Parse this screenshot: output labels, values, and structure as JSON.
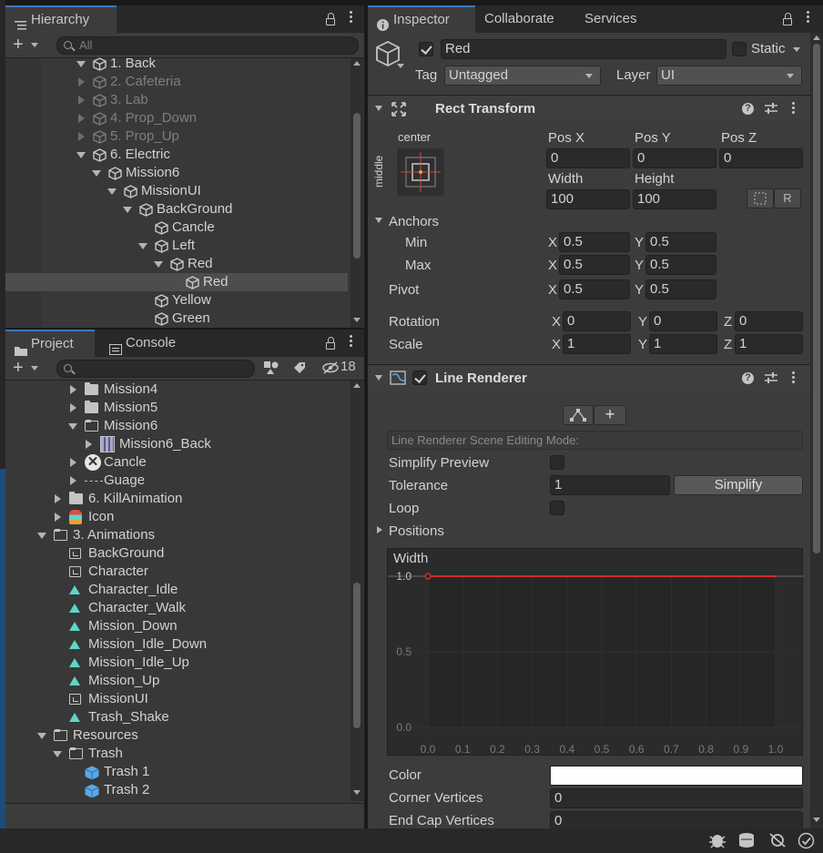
{
  "hierarchy": {
    "tab": "Hierarchy",
    "search_placeholder": "All",
    "items": [
      {
        "label": "1. Back",
        "expanded": true,
        "dim": false
      },
      {
        "label": "2. Cafeteria",
        "expanded": false,
        "dim": true
      },
      {
        "label": "3. Lab",
        "expanded": false,
        "dim": true
      },
      {
        "label": "4. Prop_Down",
        "expanded": false,
        "dim": true
      },
      {
        "label": "5. Prop_Up",
        "expanded": false,
        "dim": true
      },
      {
        "label": "6. Electric",
        "expanded": true,
        "dim": false
      },
      {
        "label": "Mission6",
        "expanded": true,
        "dim": false
      },
      {
        "label": "MissionUI",
        "expanded": true,
        "dim": false
      },
      {
        "label": "BackGround",
        "expanded": true,
        "dim": false
      },
      {
        "label": "Cancle",
        "dim": false
      },
      {
        "label": "Left",
        "expanded": true,
        "dim": false
      },
      {
        "label": "Red",
        "expanded": true,
        "dim": false
      },
      {
        "label": "Red",
        "dim": false,
        "selected": true
      },
      {
        "label": "Yellow",
        "dim": false
      },
      {
        "label": "Green",
        "dim": false
      }
    ]
  },
  "project": {
    "tabs": [
      "Project",
      "Console"
    ],
    "hidden_count": "18",
    "items": [
      {
        "label": "Mission4",
        "type": "folder"
      },
      {
        "label": "Mission5",
        "type": "folder"
      },
      {
        "label": "Mission6",
        "type": "folder-open"
      },
      {
        "label": "Mission6_Back",
        "type": "sprite"
      },
      {
        "label": "Cancle",
        "type": "cancel"
      },
      {
        "label": "Guage",
        "type": "line"
      },
      {
        "label": "6. KillAnimation",
        "type": "folder"
      },
      {
        "label": "Icon",
        "type": "icon"
      },
      {
        "label": "3. Animations",
        "type": "folder-open"
      },
      {
        "label": "BackGround",
        "type": "controller"
      },
      {
        "label": "Character",
        "type": "controller"
      },
      {
        "label": "Character_Idle",
        "type": "anim"
      },
      {
        "label": "Character_Walk",
        "type": "anim"
      },
      {
        "label": "Mission_Down",
        "type": "anim"
      },
      {
        "label": "Mission_Idle_Down",
        "type": "anim"
      },
      {
        "label": "Mission_Idle_Up",
        "type": "anim"
      },
      {
        "label": "Mission_Up",
        "type": "anim"
      },
      {
        "label": "MissionUI",
        "type": "controller"
      },
      {
        "label": "Trash_Shake",
        "type": "anim"
      },
      {
        "label": "Resources",
        "type": "folder-open"
      },
      {
        "label": "Trash",
        "type": "folder-open"
      },
      {
        "label": "Trash 1",
        "type": "prefab"
      },
      {
        "label": "Trash 2",
        "type": "prefab"
      }
    ]
  },
  "inspector": {
    "tabs": [
      "Inspector",
      "Collaborate",
      "Services"
    ],
    "object_name": "Red",
    "static_label": "Static",
    "tag_label": "Tag",
    "tag_value": "Untagged",
    "layer_label": "Layer",
    "layer_value": "UI",
    "rect_transform": {
      "title": "Rect Transform",
      "anchor_h": "center",
      "anchor_v": "middle",
      "pos_x_label": "Pos X",
      "pos_y_label": "Pos Y",
      "pos_z_label": "Pos Z",
      "pos_x": "0",
      "pos_y": "0",
      "pos_z": "0",
      "width_label": "Width",
      "height_label": "Height",
      "width": "100",
      "height": "100",
      "anchors_label": "Anchors",
      "min_label": "Min",
      "max_label": "Max",
      "min_x": "0.5",
      "min_y": "0.5",
      "max_x": "0.5",
      "max_y": "0.5",
      "pivot_label": "Pivot",
      "pivot_x": "0.5",
      "pivot_y": "0.5",
      "rotation_label": "Rotation",
      "rot_x": "0",
      "rot_y": "0",
      "rot_z": "0",
      "scale_label": "Scale",
      "scale_x": "1",
      "scale_y": "1",
      "scale_z": "1",
      "x": "X",
      "y": "Y",
      "z": "Z",
      "raw_button": "R"
    },
    "line_renderer": {
      "title": "Line Renderer",
      "editing_mode": "Line Renderer Scene Editing Mode:",
      "simplify_preview_label": "Simplify Preview",
      "tolerance_label": "Tolerance",
      "tolerance": "1",
      "simplify_button": "Simplify",
      "loop_label": "Loop",
      "positions_label": "Positions",
      "width_label": "Width",
      "curve_y_labels": [
        "1.0",
        "0.5",
        "0.0"
      ],
      "curve_x_labels": [
        "0.0",
        "0.1",
        "0.2",
        "0.3",
        "0.4",
        "0.5",
        "0.6",
        "0.7",
        "0.8",
        "0.9",
        "1.0"
      ],
      "curve_value": 1.0,
      "color_label": "Color",
      "corner_vertices_label": "Corner Vertices",
      "corner_vertices": "0",
      "end_cap_vertices_label": "End Cap Vertices",
      "end_cap_vertices": "0"
    }
  },
  "colors": {
    "accent": "#3a79bb",
    "curve": "#d42a2a",
    "anim_icon": "#5fd5c8",
    "prefab_icon": "#5aa7e8"
  }
}
